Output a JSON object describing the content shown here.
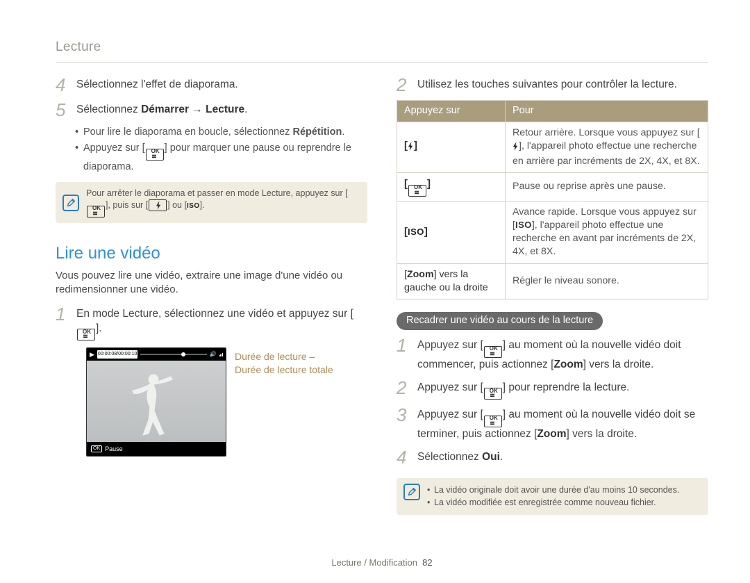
{
  "header": "Lecture",
  "left": {
    "step4": {
      "num": "4",
      "text": "Sélectionnez l'effet de diaporama."
    },
    "step5": {
      "num": "5",
      "text_pre": "Sélectionnez ",
      "bold1": "Démarrer",
      "arrow": " → ",
      "bold2": "Lecture",
      "text_post": "."
    },
    "bullets": [
      {
        "pre": "Pour lire le diaporama en boucle, sélectionnez ",
        "bold": "Répétition",
        "post": "."
      },
      {
        "pre": "Appuyez sur [",
        "post": "] pour marquer une pause ou reprendre le diaporama."
      }
    ],
    "note": {
      "pre": "Pour arrêter le diaporama et passer en mode Lecture, appuyez sur [",
      "mid": "], puis sur [",
      "or": "] ou [",
      "iso": "ISO",
      "end": "]."
    },
    "section_title": "Lire une vidéo",
    "section_desc": "Vous pouvez lire une vidéo, extraire une image d'une vidéo ou redimensionner une vidéo.",
    "step1": {
      "num": "1",
      "pre": "En mode Lecture, sélectionnez une vidéo et appuyez sur [",
      "post": "]."
    },
    "thumb": {
      "time": "00:00:08/00:00:10",
      "pause": "Pause",
      "caption1": "Durée de lecture –",
      "caption2": "Durée de lecture totale"
    }
  },
  "right": {
    "step2": {
      "num": "2",
      "text": "Utilisez les touches suivantes pour contrôler la lecture."
    },
    "table": {
      "head": [
        "Appuyez sur",
        "Pour"
      ],
      "rows": [
        {
          "key_type": "flash",
          "desc_pre": "Retour arrière. Lorsque vous appuyez sur [",
          "desc_post": "], l'appareil photo effectue une recherche en arrière par incréments de 2X, 4X, et 8X."
        },
        {
          "key_type": "ok",
          "desc": "Pause ou reprise après une pause."
        },
        {
          "key_type": "iso",
          "desc_pre": "Avance rapide. Lorsque vous appuyez sur [",
          "desc_bold": "ISO",
          "desc_post": "], l'appareil photo effectue une recherche en avant par incréments de 2X, 4X, et 8X."
        },
        {
          "key_plain_pre": "[",
          "key_bold": "Zoom",
          "key_plain_post": "] vers la gauche ou la droite",
          "desc": "Régler le niveau sonore."
        }
      ]
    },
    "pill": "Recadrer une vidéo au cours de la lecture",
    "r_step1": {
      "num": "1",
      "pre": "Appuyez sur [",
      "mid": "] au moment où la nouvelle vidéo doit commencer, puis actionnez [",
      "bold": "Zoom",
      "post": "] vers la droite."
    },
    "r_step2": {
      "num": "2",
      "pre": "Appuyez sur [",
      "post": "] pour reprendre la lecture."
    },
    "r_step3": {
      "num": "3",
      "pre": "Appuyez sur [",
      "mid": "] au moment où la nouvelle vidéo doit se terminer, puis actionnez [",
      "bold": "Zoom",
      "post": "] vers la droite."
    },
    "r_step4": {
      "num": "4",
      "pre": "Sélectionnez ",
      "bold": "Oui",
      "post": "."
    },
    "note_items": [
      "La vidéo originale doit avoir une durée d'au moins 10 secondes.",
      "La vidéo modifiée est enregistrée comme nouveau fichier."
    ]
  },
  "footer": {
    "text": "Lecture / Modification",
    "page": "82"
  }
}
